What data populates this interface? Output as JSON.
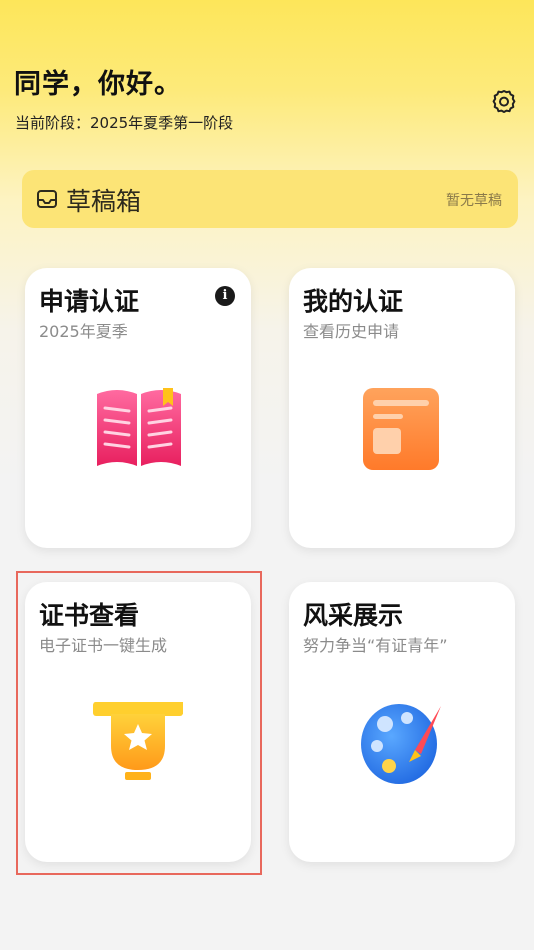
{
  "header": {
    "greeting": "同学，你好。",
    "stage": "当前阶段：2025年夏季第一阶段",
    "settings_icon": "gear-icon"
  },
  "drafts": {
    "icon": "inbox-icon",
    "title": "草稿箱",
    "status": "暂无草稿"
  },
  "cards": {
    "apply": {
      "title": "申请认证",
      "subtitle": "2025年夏季",
      "info_icon": "info-icon",
      "info_glyph": "i",
      "icon": "book-icon"
    },
    "mine": {
      "title": "我的认证",
      "subtitle": "查看历史申请",
      "icon": "document-icon"
    },
    "cert": {
      "title": "证书查看",
      "subtitle": "电子证书一键生成",
      "icon": "trophy-icon"
    },
    "show": {
      "title": "风采展示",
      "subtitle": "努力争当“有证青年”",
      "icon": "palette-icon"
    }
  },
  "colors": {
    "header_yellow": "#fde65a",
    "drafts_bg": "#fce476",
    "book_pink": "#f0407a",
    "doc_orange": "#ff8a3d",
    "trophy_yellow": "#ffc21a",
    "palette_blue": "#2f7df0",
    "highlight_red": "#e8685c"
  }
}
